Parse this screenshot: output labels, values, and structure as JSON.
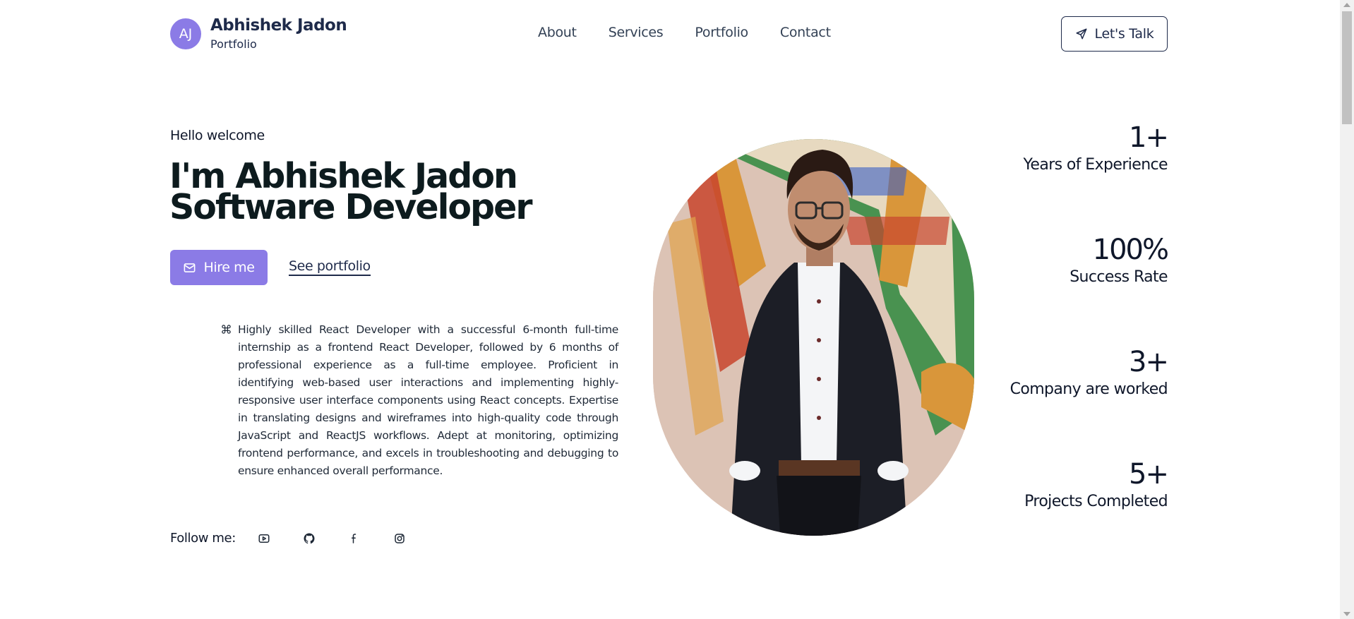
{
  "header": {
    "avatar_initials": "AJ",
    "name": "Abhishek Jadon",
    "subtitle": "Portfolio",
    "nav": [
      "About",
      "Services",
      "Portfolio",
      "Contact"
    ],
    "cta_label": "Let's Talk",
    "cta_icon": "send-icon"
  },
  "hero": {
    "greeting": "Hello welcome",
    "title_line1": "I'm Abhishek Jadon",
    "title_line2": "Software Developer",
    "hire_label": "Hire me",
    "hire_icon": "mail-icon",
    "portfolio_label": "See portfolio",
    "bio_icon": "command-icon",
    "bio": "Highly skilled React Developer with a successful 6-month full-time internship as a frontend React Developer, followed by 6 months of professional experience as a full-time employee. Proficient in identifying web-based user interactions and implementing highly-responsive user interface components using React concepts. Expertise in translating designs and wireframes into high-quality code through JavaScript and ReactJS workflows. Adept at monitoring, optimizing frontend performance, and excels in troubleshooting and debugging to ensure enhanced overall performance.",
    "follow_label": "Follow me:",
    "social_icons": [
      "youtube-icon",
      "github-icon",
      "facebook-icon",
      "instagram-icon"
    ]
  },
  "stats": [
    {
      "value": "1+",
      "label": "Years of Experience"
    },
    {
      "value": "100%",
      "label": "Success Rate"
    },
    {
      "value": "3+",
      "label": "Company are worked"
    },
    {
      "value": "5+",
      "label": "Projects Completed"
    }
  ],
  "colors": {
    "accent": "#8b7be6",
    "navy": "#1e2a4a",
    "text": "#0f172a"
  }
}
